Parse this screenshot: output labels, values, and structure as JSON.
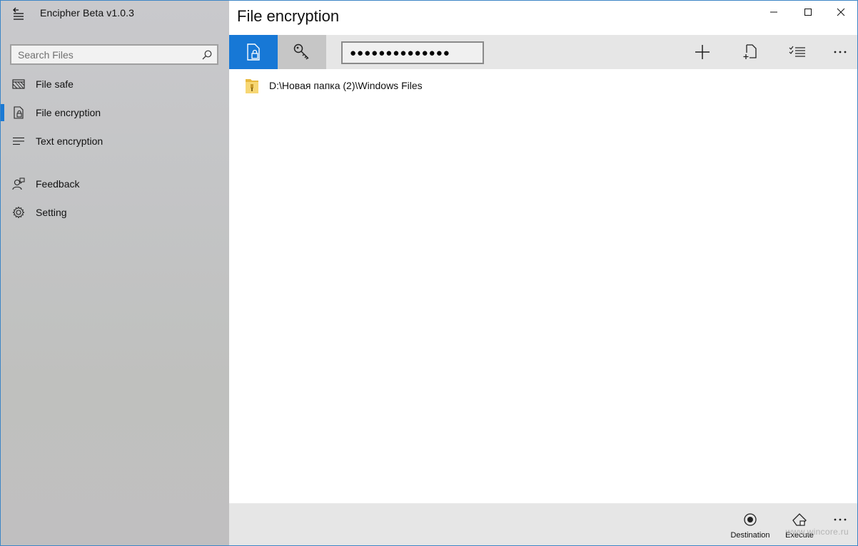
{
  "app": {
    "title": "Encipher  Beta v1.0.3"
  },
  "search": {
    "placeholder": "Search Files"
  },
  "sidebar": {
    "items": [
      {
        "label": "File safe",
        "icon": "file-safe-icon"
      },
      {
        "label": "File encryption",
        "icon": "file-lock-icon",
        "active": true
      },
      {
        "label": "Text encryption",
        "icon": "text-lines-icon"
      },
      {
        "label": "Feedback",
        "icon": "feedback-person-icon"
      },
      {
        "label": "Setting",
        "icon": "gear-icon"
      }
    ]
  },
  "page": {
    "title": "File encryption"
  },
  "toolbar": {
    "password_value": "●●●●●●●●●●●●●●"
  },
  "files": [
    {
      "path": "D:\\Новая папка (2)\\Windows Files",
      "icon": "folder-icon"
    }
  ],
  "bottombar": {
    "destination_label": "Destination",
    "execute_label": "Execute"
  },
  "watermark": "www.wincore.ru",
  "colors": {
    "accent": "#1778d6",
    "sidebar_bg": "#c5c5c7",
    "toolbar_bg": "#e6e6e6",
    "folder": "#f5d36a"
  }
}
